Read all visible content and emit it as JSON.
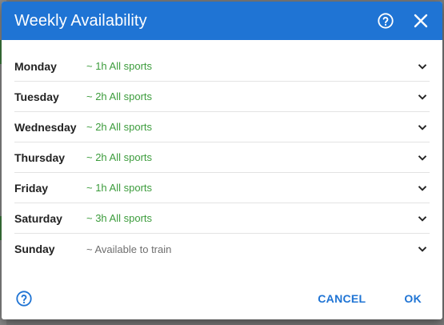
{
  "dialog": {
    "title": "Weekly Availability",
    "help_icon": "help-circle-icon",
    "close_icon": "close-icon"
  },
  "days": [
    {
      "day": "Monday",
      "summary": "~ 1h All sports",
      "status": "green"
    },
    {
      "day": "Tuesday",
      "summary": "~ 2h All sports",
      "status": "green"
    },
    {
      "day": "Wednesday",
      "summary": "~ 2h All sports",
      "status": "green"
    },
    {
      "day": "Thursday",
      "summary": "~ 2h All sports",
      "status": "green"
    },
    {
      "day": "Friday",
      "summary": "~ 1h All sports",
      "status": "green"
    },
    {
      "day": "Saturday",
      "summary": "~ 3h All sports",
      "status": "green"
    },
    {
      "day": "Sunday",
      "summary": "~ Available to train",
      "status": "grey"
    }
  ],
  "footer": {
    "help_icon": "help-circle-icon",
    "cancel_label": "CANCEL",
    "ok_label": "OK"
  },
  "colors": {
    "header": "#1f74d4",
    "accent": "#1f74d4",
    "green_text": "#3c9c3c",
    "grey_text": "#6f6f6f"
  }
}
